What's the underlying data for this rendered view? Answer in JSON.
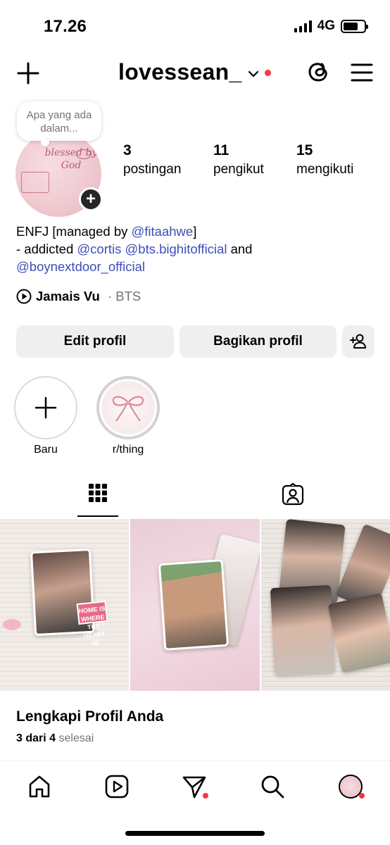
{
  "status_bar": {
    "time": "17.26",
    "network": "4G"
  },
  "header": {
    "username": "lovessean_",
    "icons": [
      "plus-icon",
      "chevron-down-icon",
      "threads-icon",
      "menu-icon"
    ]
  },
  "profile": {
    "note_placeholder": "Apa yang ada dalam...",
    "avatar_text": "blessed by God",
    "stats": [
      {
        "value": "3",
        "label": "postingan"
      },
      {
        "value": "11",
        "label": "pengikut"
      },
      {
        "value": "15",
        "label": "mengikuti"
      }
    ],
    "bio": {
      "line1_prefix": "ENFJ [managed by ",
      "line1_mention": "@fitaahwe",
      "line1_suffix": "]",
      "line2_prefix": "- addicted ",
      "line2_mention1": "@cortis",
      "line2_mention2": "@bts.bighitofficial",
      "line2_suffix": " and",
      "line3_mention": "@boynextdoor_official"
    },
    "music": {
      "song": "Jamais Vu",
      "separator": " · ",
      "artist": "BTS"
    }
  },
  "buttons": {
    "edit_profile": "Edit profil",
    "share_profile": "Bagikan profil"
  },
  "highlights": [
    {
      "label": "Baru"
    },
    {
      "label": "r/thing"
    }
  ],
  "tabs": [
    "grid-icon",
    "tagged-icon"
  ],
  "grid_posts": [
    {
      "sticker_text": "HOME IS WHERE THE HEART IS"
    },
    {},
    {}
  ],
  "complete_profile": {
    "title": "Lengkapi Profil Anda",
    "progress_bold": "3 dari 4",
    "progress_muted": "selesai"
  },
  "bottom_nav": [
    "home-icon",
    "reels-icon",
    "messages-icon",
    "search-icon",
    "profile-avatar"
  ],
  "colors": {
    "mention": "#3d4eb8",
    "notification": "#ff3040",
    "button_bg": "#efeff0"
  }
}
